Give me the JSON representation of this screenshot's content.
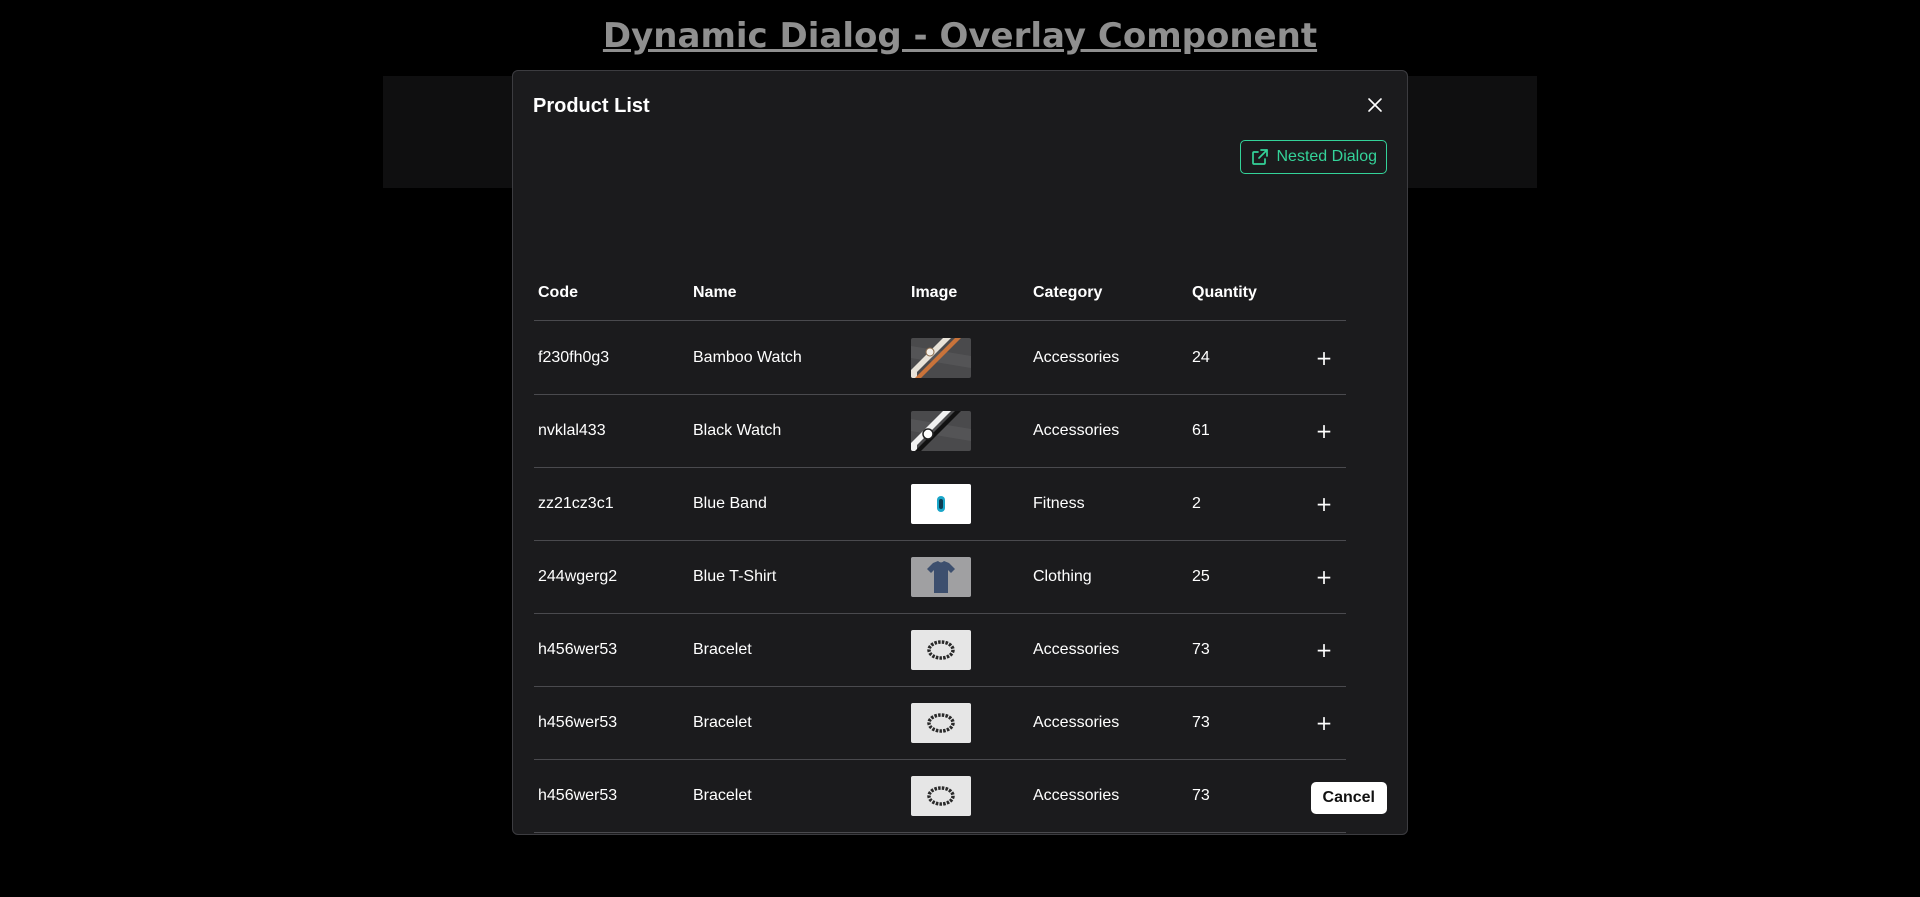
{
  "page": {
    "title": "Dynamic Dialog - Overlay Component"
  },
  "dialog": {
    "title": "Product List",
    "close_icon": "close-icon",
    "nested_button": {
      "label": "Nested Dialog",
      "icon": "external-link-icon"
    },
    "cancel_label": "Cancel"
  },
  "table": {
    "headers": [
      "Code",
      "Name",
      "Image",
      "Category",
      "Quantity"
    ],
    "rows": [
      {
        "code": "f230fh0g3",
        "name": "Bamboo Watch",
        "image": "bamboo-watch-thumbnail",
        "category": "Accessories",
        "quantity": "24",
        "action": "+"
      },
      {
        "code": "nvklal433",
        "name": "Black Watch",
        "image": "black-watch-thumbnail",
        "category": "Accessories",
        "quantity": "61",
        "action": "+"
      },
      {
        "code": "zz21cz3c1",
        "name": "Blue Band",
        "image": "blue-band-thumbnail",
        "category": "Fitness",
        "quantity": "2",
        "action": "+"
      },
      {
        "code": "244wgerg2",
        "name": "Blue T-Shirt",
        "image": "blue-t-shirt-thumbnail",
        "category": "Clothing",
        "quantity": "25",
        "action": "+"
      },
      {
        "code": "h456wer53",
        "name": "Bracelet",
        "image": "bracelet-thumbnail",
        "category": "Accessories",
        "quantity": "73",
        "action": "+"
      },
      {
        "code": "h456wer53",
        "name": "Bracelet",
        "image": "bracelet-thumbnail",
        "category": "Accessories",
        "quantity": "73",
        "action": "+"
      },
      {
        "code": "h456wer53",
        "name": "Bracelet",
        "image": "bracelet-thumbnail",
        "category": "Accessories",
        "quantity": "73",
        "action": "+"
      }
    ]
  },
  "colors": {
    "background": "#000000",
    "dialog_bg": "#1b1b1d",
    "accent_green": "#34d399",
    "title_gray": "#8f8f8f"
  }
}
